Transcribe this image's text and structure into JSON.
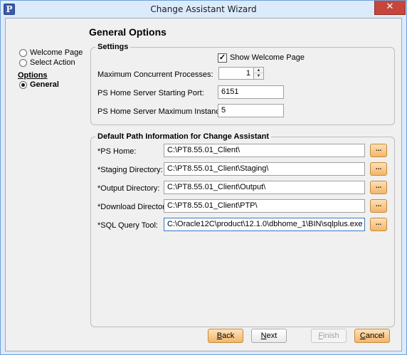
{
  "window": {
    "title": "Change Assistant Wizard",
    "app_icon_glyph": "P",
    "close_glyph": "✕"
  },
  "page": {
    "title": "General Options"
  },
  "nav": {
    "items": [
      {
        "label": "Welcome Page",
        "selected": false
      },
      {
        "label": "Select Action",
        "selected": false
      }
    ],
    "section_heading": "Options",
    "sub_items": [
      {
        "label": "General",
        "selected": true
      }
    ]
  },
  "settings": {
    "title": "Settings",
    "show_welcome_label": "Show Welcome Page",
    "show_welcome_checked": "✓",
    "max_processes_label": "Maximum Concurrent Processes:",
    "max_processes_value": "1",
    "start_port_label": "PS Home Server Starting Port:",
    "start_port_value": "6151",
    "max_instances_label": "PS Home Server Maximum Instances:",
    "max_instances_value": "5"
  },
  "paths": {
    "title": "Default Path Information for Change Assistant",
    "browse_label": "...",
    "rows": [
      {
        "label": "*PS Home:",
        "value": "C:\\PT8.55.01_Client\\"
      },
      {
        "label": "*Staging Directory:",
        "value": "C:\\PT8.55.01_Client\\Staging\\"
      },
      {
        "label": "*Output Directory:",
        "value": "C:\\PT8.55.01_Client\\Output\\"
      },
      {
        "label": "*Download Directory:",
        "value": "C:\\PT8.55.01_Client\\PTP\\"
      },
      {
        "label": "*SQL Query Tool:",
        "value": "C:\\Oracle12C\\product\\12.1.0\\dbhome_1\\BIN\\sqlplus.exe"
      }
    ]
  },
  "buttons": {
    "back": "Back",
    "next": "Next",
    "finish": "Finish",
    "cancel": "Cancel"
  },
  "colors": {
    "accent_button": "#f3b56b",
    "title_bar": "#dcebfb",
    "close": "#c7463c"
  }
}
